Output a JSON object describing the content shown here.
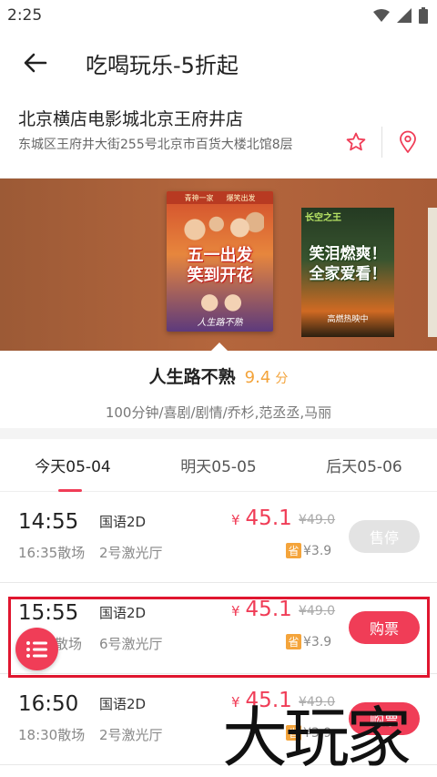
{
  "status": {
    "time": "2:25"
  },
  "header": {
    "title": "吃喝玩乐-5折起"
  },
  "cinema": {
    "name": "北京横店电影城北京王府井店",
    "address": "东城区王府井大街255号北京市百货大楼北馆8层"
  },
  "posters": {
    "main": {
      "top_left": "青神一家",
      "top_right": "爆笑出发",
      "big_line1": "五一出发",
      "big_line2": "笑到开花",
      "small_title": "人生路不熟"
    },
    "second": {
      "logo": "长空之王",
      "big_line1": "笑泪燃爽！",
      "big_line2": "全家爱看！",
      "bottom": "高燃热映中"
    }
  },
  "movie": {
    "title": "人生路不熟",
    "score": "9.4",
    "score_unit": "分",
    "meta": "100分钟/喜剧/剧情/乔杉,范丞丞,马丽"
  },
  "tabs": [
    {
      "label": "今天05-04",
      "active": true
    },
    {
      "label": "明天05-05",
      "active": false
    },
    {
      "label": "后天05-06",
      "active": false
    }
  ],
  "showtimes": [
    {
      "start": "14:55",
      "end": "16:35散场",
      "lang": "国语2D",
      "hall": "2号激光厅",
      "currency": "¥",
      "price": "45.1",
      "original": "¥49.0",
      "save_badge": "省",
      "save": "¥3.9",
      "button": "售停",
      "available": false
    },
    {
      "start": "15:55",
      "end": "散场",
      "lang": "国语2D",
      "hall": "6号激光厅",
      "currency": "¥",
      "price": "45.1",
      "original": "¥49.0",
      "save_badge": "省",
      "save": "¥3.9",
      "button": "购票",
      "available": true
    },
    {
      "start": "16:50",
      "end": "18:30散场",
      "lang": "国语2D",
      "hall": "2号激光厅",
      "currency": "¥",
      "price": "45.1",
      "original": "¥49.0",
      "save_badge": "省",
      "save": "¥3.9",
      "button": "购票",
      "available": true
    }
  ],
  "watermark": "大玩家",
  "colors": {
    "accent": "#f03d57",
    "score": "#f3a33a",
    "highlight": "#e0162f",
    "save_badge": "#f4a43b"
  },
  "icons": [
    "back-arrow-icon",
    "star-outline-icon",
    "location-pin-icon",
    "wifi-icon",
    "signal-icon",
    "battery-icon",
    "list-menu-icon"
  ]
}
